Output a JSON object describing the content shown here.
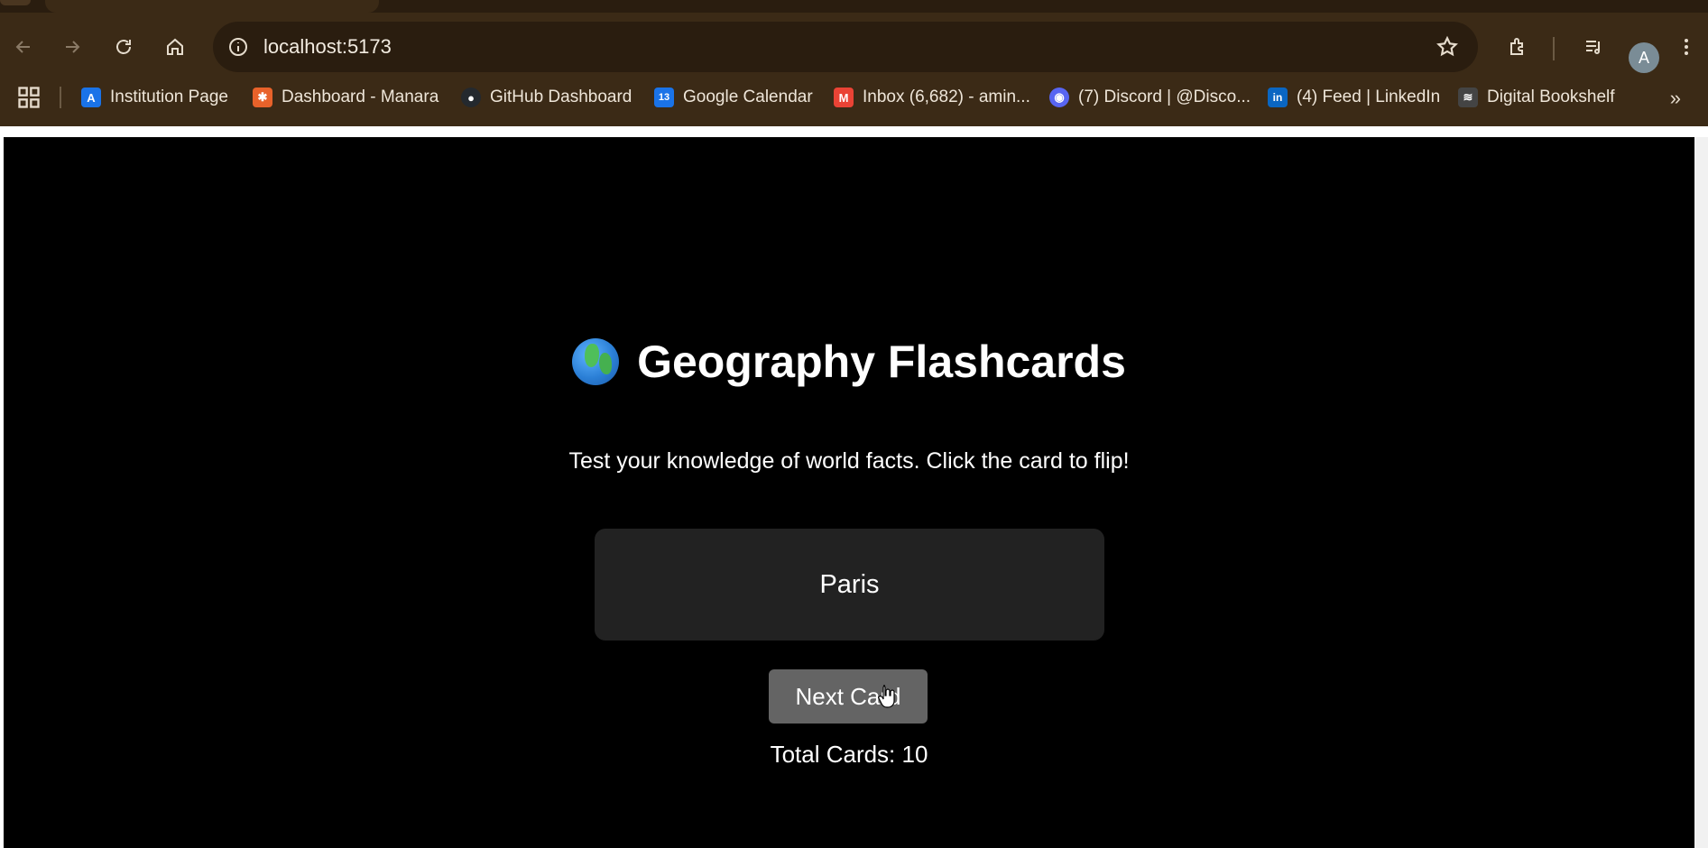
{
  "browser": {
    "url": "localhost:5173",
    "profile_initial": "A",
    "bookmarks": [
      {
        "label": "Institution Page",
        "icon": "institution-favicon",
        "color": "#1a73e8",
        "glyph": "A"
      },
      {
        "label": "Dashboard - Manara",
        "icon": "manara-favicon",
        "color": "#e8622a",
        "glyph": "✱"
      },
      {
        "label": "GitHub Dashboard",
        "icon": "github-favicon",
        "color": "#24292e",
        "glyph": "●"
      },
      {
        "label": "Google Calendar",
        "icon": "calendar-favicon",
        "color": "#1a73e8",
        "glyph": "13"
      },
      {
        "label": "Inbox (6,682) - amin...",
        "icon": "gmail-favicon",
        "color": "#ea4335",
        "glyph": "M"
      },
      {
        "label": "(7) Discord | @Disco...",
        "icon": "discord-favicon",
        "color": "#5865f2",
        "glyph": "◉"
      },
      {
        "label": "(4) Feed | LinkedIn",
        "icon": "linkedin-favicon",
        "color": "#0a66c2",
        "glyph": "in"
      },
      {
        "label": "Digital Bookshelf",
        "icon": "bookshelf-favicon",
        "color": "#444444",
        "glyph": "≋"
      }
    ]
  },
  "app": {
    "title": "Geography Flashcards",
    "subtitle": "Test your knowledge of world facts. Click the card to flip!",
    "card_text": "Paris",
    "next_button": "Next Card",
    "total_cards": "Total Cards: 10"
  },
  "colors": {
    "chrome": "#3b2a16",
    "app_background": "#000000",
    "card_background": "#222222",
    "button_background": "#646464"
  }
}
